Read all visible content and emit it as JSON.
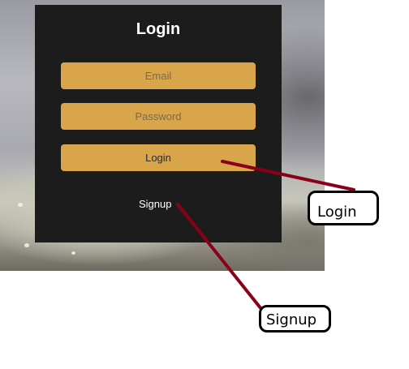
{
  "login_form": {
    "title": "Login",
    "email_placeholder": "Email",
    "password_placeholder": "Password",
    "login_button_label": "Login",
    "signup_link_label": "Signup"
  },
  "annotations": {
    "login_callout": "Login",
    "signup_callout": "Signup",
    "arrow_color": "#8b0019"
  },
  "colors": {
    "panel_background": "#1c1c1c",
    "field_background": "#d9a54b"
  }
}
